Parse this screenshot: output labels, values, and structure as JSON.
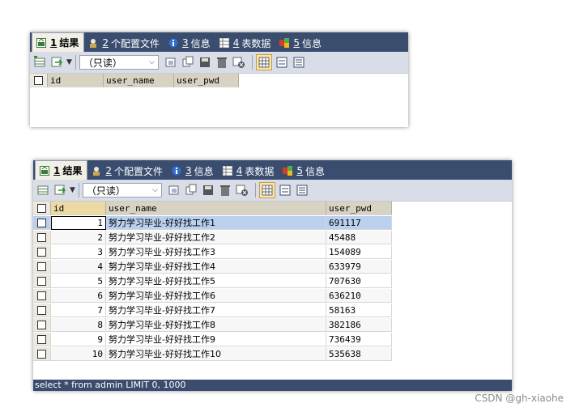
{
  "tabs": [
    {
      "num": "1",
      "label": "结果",
      "icon": "result-grid-icon"
    },
    {
      "num": "2",
      "label": "个配置文件",
      "icon": "profile-icon"
    },
    {
      "num": "3",
      "label": "信息",
      "icon": "info-icon"
    },
    {
      "num": "4",
      "label": "表数据",
      "icon": "table-data-icon"
    },
    {
      "num": "5",
      "label": "信息",
      "icon": "info-alt-icon"
    }
  ],
  "toolbar": {
    "mode_select": "（只读）",
    "icons": [
      "add-row-icon",
      "export-icon",
      "dropdown-arrow-icon",
      "duplicate-icon",
      "copy-icon",
      "save-icon",
      "delete-icon",
      "cancel-icon",
      "grid-view-icon",
      "form-view-icon",
      "text-view-icon"
    ]
  },
  "empty_result": {
    "columns": [
      "id",
      "user_name",
      "user_pwd"
    ]
  },
  "result": {
    "columns": [
      "id",
      "user_name",
      "user_pwd"
    ],
    "rows": [
      [
        "1",
        "努力学习毕业-好好找工作1",
        "691117"
      ],
      [
        "2",
        "努力学习毕业-好好找工作2",
        "45488"
      ],
      [
        "3",
        "努力学习毕业-好好找工作3",
        "154089"
      ],
      [
        "4",
        "努力学习毕业-好好找工作4",
        "633979"
      ],
      [
        "5",
        "努力学习毕业-好好找工作5",
        "707630"
      ],
      [
        "6",
        "努力学习毕业-好好找工作6",
        "636210"
      ],
      [
        "7",
        "努力学习毕业-好好找工作7",
        "58163"
      ],
      [
        "8",
        "努力学习毕业-好好找工作8",
        "382186"
      ],
      [
        "9",
        "努力学习毕业-好好找工作9",
        "736439"
      ],
      [
        "10",
        "努力学习毕业-好好找工作10",
        "535638"
      ]
    ],
    "selected_row": 0
  },
  "status": "select * from admin LIMIT 0, 1000",
  "watermark": "CSDN @gh-xiaohe",
  "colors": {
    "tabbar": "#3a4d6e",
    "toolbar": "#d8dde8",
    "header": "#d7d2c2",
    "selected": "#b9d0ef"
  }
}
